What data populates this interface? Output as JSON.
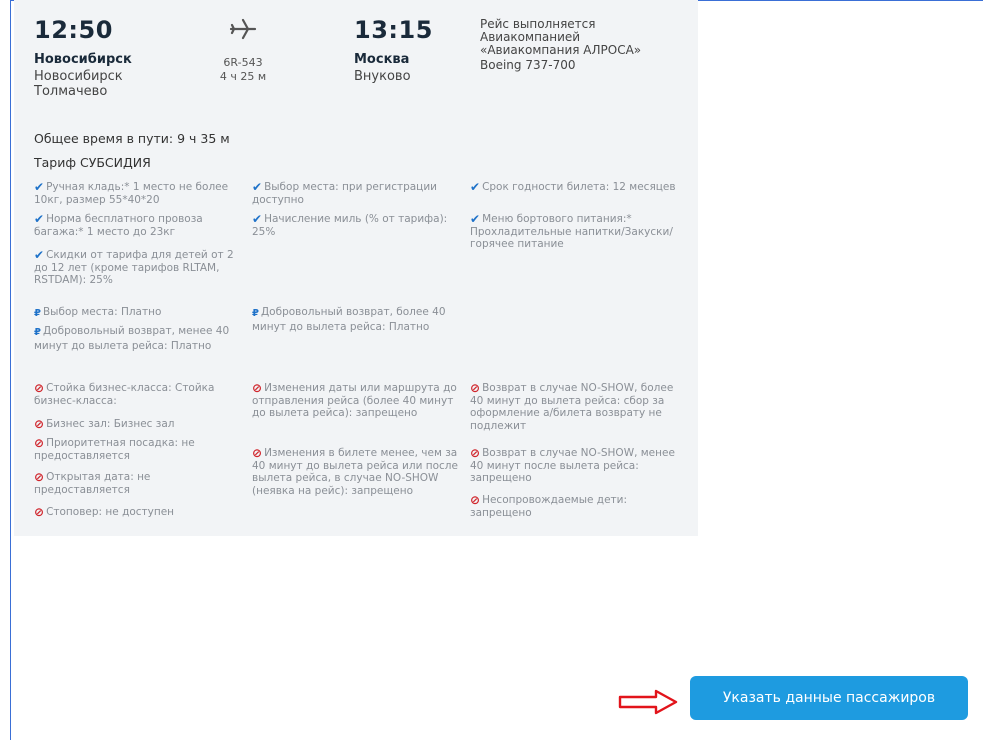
{
  "flight": {
    "departure": {
      "time": "12:50",
      "city": "Новосибирск",
      "airport_line1": "Новосибирск",
      "airport_line2": "Толмачево"
    },
    "flight_number": "6R-543",
    "duration": "4 ч 25 м",
    "arrival": {
      "time": "13:15",
      "city": "Москва",
      "airport": "Внуково"
    },
    "operator": {
      "line1": "Рейс выполняется",
      "line2": "Авиакомпанией",
      "line3": "«Авиакомпания АЛРОСА»",
      "aircraft": "Boeing 737-700"
    }
  },
  "total_time": "Общее время в пути: 9 ч 35 м",
  "tariff": "Тариф СУБСИДИЯ",
  "included": [
    "Ручная кладь:* 1 место не более 10кг, размер 55*40*20",
    "Норма бесплатного провоза багажа:* 1 место до 23кг",
    "Скидки от тарифа для детей от 2 до 12 лет (кроме тарифов RLTAM, RSTDAM): 25%",
    "Выбор места: при регистрации доступно",
    "Начисление миль (% от тарифа): 25%",
    "Срок годности билета: 12 месяцев",
    "Меню бортового питания:* Прохладительные напитки/Закуски/горячее питание"
  ],
  "paid": [
    "Выбор места: Платно",
    "Добровольный возврат, менее 40 минут до вылета рейса: Платно",
    "Добровольный возврат, более 40 минут до вылета рейса: Платно"
  ],
  "not_available": [
    "Стойка бизнес-класса: Стойка бизнес-класса:",
    "Бизнес зал: Бизнес зал",
    "Приоритетная посадка: не предоставляется",
    "Открытая дата: не предоставляется",
    "Стоповер: не доступен",
    "Изменения даты или маршрута до отправления рейса (более 40 минут до вылета рейса): запрещено",
    "Изменения в билете менее, чем за 40 минут до вылета рейса или после вылета рейса, в случае NO-SHOW (неявка на рейс): запрещено",
    "Возврат в случае NO-SHOW, более 40 минут до вылета рейса: сбор за оформление а/билета возврату не подлежит",
    "Возврат в случае NO-SHOW, менее 40 минут после вылета рейса: запрещено",
    "Несопровождаемые дети: запрещено"
  ],
  "icons": {
    "plane": "plane-icon",
    "included": "checkmark-icon",
    "paid": "ruble-icon",
    "not_available": "prohibited-icon",
    "arrow": "red-arrow-icon"
  },
  "colors": {
    "accent": "#1e9be0",
    "check": "#1f72c9",
    "prohibited": "#d0242b",
    "card_bg": "#f2f4f6",
    "frame": "#3a6fd6"
  },
  "action": {
    "button_label": "Указать данные пассажиров"
  }
}
